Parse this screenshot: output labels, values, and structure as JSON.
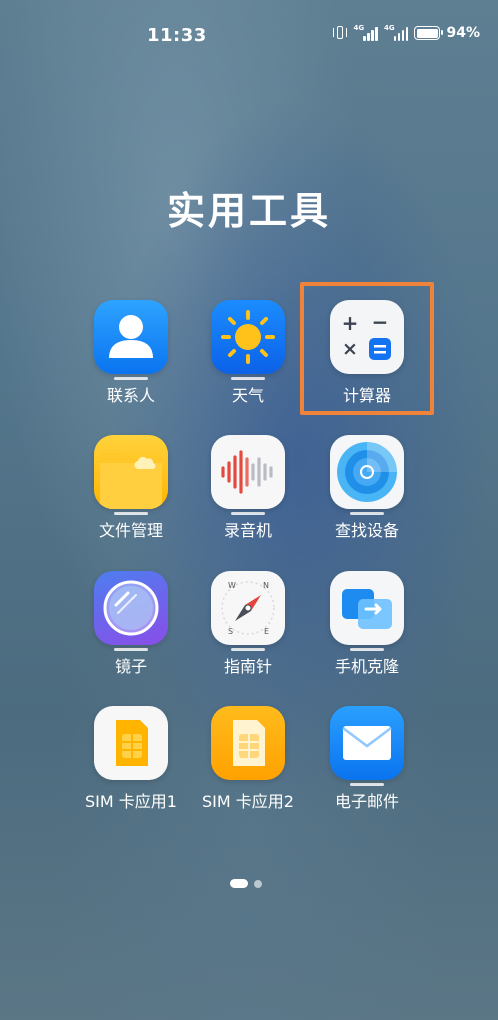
{
  "status_bar": {
    "time": "11:33",
    "battery": "94%",
    "network_tag_1": "4G",
    "network_tag_2": "4G"
  },
  "folder": {
    "title": "实用工具",
    "apps": [
      {
        "label": "联系人",
        "icon": "contacts-icon"
      },
      {
        "label": "天气",
        "icon": "weather-icon"
      },
      {
        "label": "计算器",
        "icon": "calculator-icon"
      },
      {
        "label": "文件管理",
        "icon": "file-manager-icon"
      },
      {
        "label": "录音机",
        "icon": "recorder-icon"
      },
      {
        "label": "查找设备",
        "icon": "find-device-icon"
      },
      {
        "label": "镜子",
        "icon": "mirror-icon"
      },
      {
        "label": "指南针",
        "icon": "compass-icon"
      },
      {
        "label": "手机克隆",
        "icon": "phone-clone-icon"
      },
      {
        "label": "SIM 卡应用1",
        "icon": "sim-card-icon"
      },
      {
        "label": "SIM 卡应用2",
        "icon": "sim-card-icon"
      },
      {
        "label": "电子邮件",
        "icon": "email-icon"
      }
    ]
  },
  "calculator_glyphs": {
    "plus": "+",
    "minus": "−",
    "times": "×"
  },
  "compass_letters": {
    "n": "N",
    "s": "S",
    "e": "E",
    "w": "W"
  },
  "highlighted_app": "计算器",
  "colors": {
    "highlight": "#f0833a"
  },
  "pager": {
    "pages": 2,
    "current": 1
  }
}
